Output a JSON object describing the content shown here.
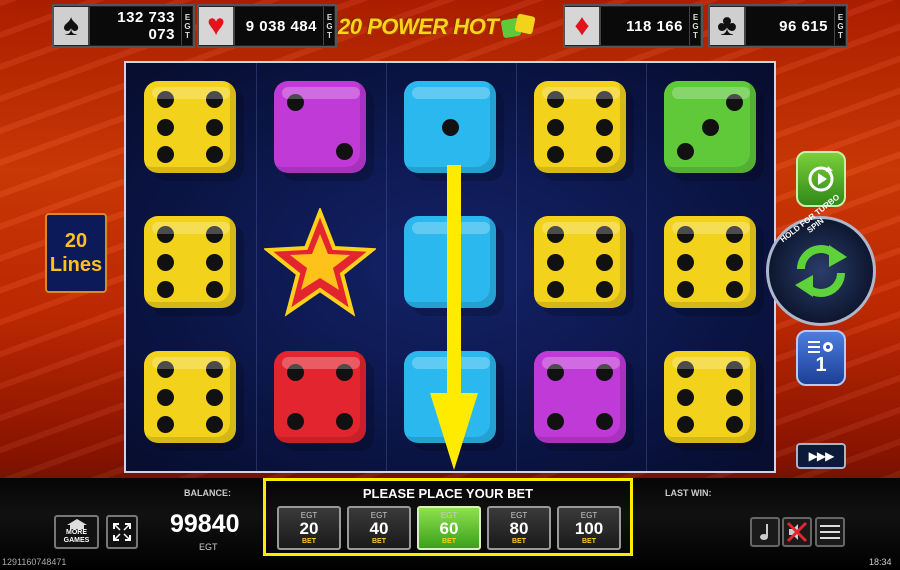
{
  "jackpots": [
    {
      "suit": "spade",
      "symbol": "♠",
      "value": "132 733 073",
      "egt": "E G T"
    },
    {
      "suit": "heart",
      "symbol": "♥",
      "value": "9 038 484",
      "egt": "E G T"
    },
    {
      "suit": "diamond",
      "symbol": "♦",
      "value": "118 166",
      "egt": "E G T"
    },
    {
      "suit": "club",
      "symbol": "♣",
      "value": "96 615",
      "egt": "E G T"
    }
  ],
  "logo": {
    "text": "20 POWER HOT"
  },
  "lines": {
    "count": "20",
    "label": "Lines"
  },
  "reels": [
    [
      {
        "type": "die",
        "color": "yellow",
        "pips": 6
      },
      {
        "type": "die",
        "color": "yellow",
        "pips": 6
      },
      {
        "type": "die",
        "color": "yellow",
        "pips": 6
      }
    ],
    [
      {
        "type": "die",
        "color": "purple",
        "pips": 2
      },
      {
        "type": "star"
      },
      {
        "type": "die",
        "color": "red",
        "pips": 4
      }
    ],
    [
      {
        "type": "die",
        "color": "blue",
        "pips": 1
      },
      {
        "type": "die",
        "color": "blue",
        "pips": 0
      },
      {
        "type": "die",
        "color": "blue",
        "pips": 0
      }
    ],
    [
      {
        "type": "die",
        "color": "yellow",
        "pips": 6
      },
      {
        "type": "die",
        "color": "yellow",
        "pips": 6
      },
      {
        "type": "die",
        "color": "purple",
        "pips": 4
      }
    ],
    [
      {
        "type": "die",
        "color": "green",
        "pips": 3
      },
      {
        "type": "die",
        "color": "yellow",
        "pips": 6
      },
      {
        "type": "die",
        "color": "yellow",
        "pips": 6
      }
    ]
  ],
  "colors": {
    "yellow": "#f2d21b",
    "purple": "#c03ad8",
    "blue": "#2bb8ee",
    "red": "#e3252f",
    "green": "#5fc93a",
    "arrow": "#ffeb00",
    "bet_panel_border": "#ffeb00"
  },
  "controls": {
    "spin_label": "HOLD FOR TURBO SPIN",
    "bet_level": "1",
    "fast_forward": "▶▶▶",
    "more_games": "MORE GAMES"
  },
  "bottom": {
    "balance_label": "BALANCE:",
    "balance_value": "99840",
    "balance_currency": "EGT",
    "last_win_label": "LAST WIN:",
    "footer_id": "1291160748471",
    "time": "18:34"
  },
  "bet_panel": {
    "title": "PLEASE PLACE YOUR BET",
    "options": [
      {
        "egt": "EGT",
        "amount": "20",
        "word": "BET",
        "selected": false
      },
      {
        "egt": "EGT",
        "amount": "40",
        "word": "BET",
        "selected": false
      },
      {
        "egt": "EGT",
        "amount": "60",
        "word": "BET",
        "selected": true
      },
      {
        "egt": "EGT",
        "amount": "80",
        "word": "BET",
        "selected": false
      },
      {
        "egt": "EGT",
        "amount": "100",
        "word": "BET",
        "selected": false
      }
    ]
  }
}
